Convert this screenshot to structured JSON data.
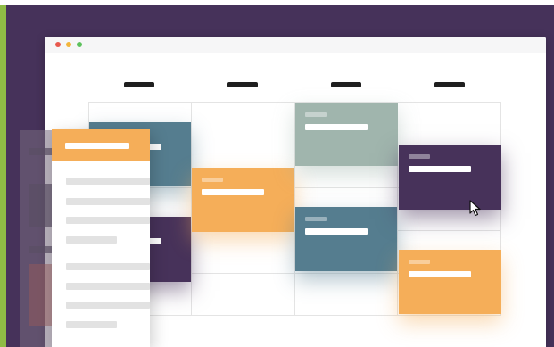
{
  "colors": {
    "background": "#46325a",
    "accent_bar": "#8fbc45",
    "orange": "#f5ae59",
    "teal": "#557d8f",
    "sage": "#a0b5ad",
    "plum": "#47325a"
  },
  "window": {
    "controls": [
      "close",
      "minimize",
      "maximize"
    ]
  },
  "calendar": {
    "columns": 4,
    "events": [
      {
        "color": "teal"
      },
      {
        "color": "plum"
      },
      {
        "color": "orange"
      },
      {
        "color": "sage"
      },
      {
        "color": "teal"
      },
      {
        "color": "plum"
      },
      {
        "color": "orange"
      }
    ]
  },
  "dropdown": {
    "header_color": "orange",
    "item_count": 8
  },
  "cursor": {
    "icon": "mouse-pointer-icon"
  }
}
